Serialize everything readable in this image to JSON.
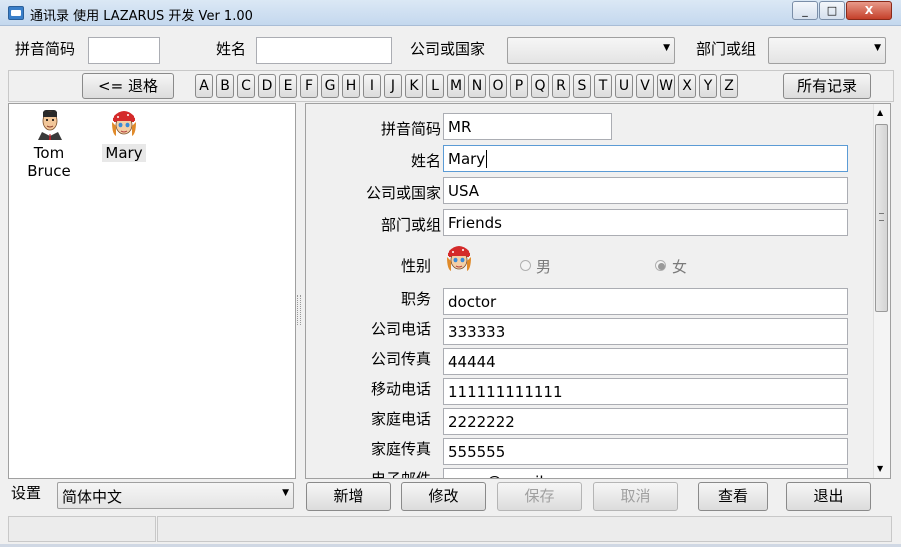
{
  "window": {
    "title": "通讯录 使用 LAZARUS 开发 Ver 1.00",
    "minimize": "_",
    "maximize": "□",
    "close": "X"
  },
  "search": {
    "pinyin_label": "拼音简码",
    "pinyin_value": "",
    "name_label": "姓名",
    "name_value": "",
    "company_label": "公司或国家",
    "company_value": "",
    "dept_label": "部门或组",
    "dept_value": ""
  },
  "nav": {
    "back_label": "<= 退格",
    "letters": [
      "A",
      "B",
      "C",
      "D",
      "E",
      "F",
      "G",
      "H",
      "I",
      "J",
      "K",
      "L",
      "M",
      "N",
      "O",
      "P",
      "Q",
      "R",
      "S",
      "T",
      "U",
      "V",
      "W",
      "X",
      "Y",
      "Z"
    ],
    "all_label": "所有记录"
  },
  "contacts": [
    {
      "name": "Tom\nBruce",
      "icon": "male-avatar-icon"
    },
    {
      "name": "Mary",
      "icon": "female-avatar-icon"
    }
  ],
  "settings": {
    "label": "设置",
    "language": "简体中文"
  },
  "form": {
    "pinyin": {
      "label": "拼音简码",
      "value": "MR"
    },
    "name": {
      "label": "姓名",
      "value": "Mary"
    },
    "company": {
      "label": "公司或国家",
      "value": "USA"
    },
    "dept": {
      "label": "部门或组",
      "value": "Friends"
    },
    "gender": {
      "label": "性别",
      "male": "男",
      "female": "女",
      "selected": "女"
    },
    "position": {
      "label": "职务",
      "value": "doctor"
    },
    "office_phone": {
      "label": "公司电话",
      "value": "333333"
    },
    "office_fax": {
      "label": "公司传真",
      "value": "44444"
    },
    "mobile": {
      "label": "移动电话",
      "value": "111111111111"
    },
    "home_phone": {
      "label": "家庭电话",
      "value": "2222222"
    },
    "home_fax": {
      "label": "家庭传真",
      "value": "555555"
    },
    "email": {
      "label": "电子邮件",
      "value": "mary@gmail.com"
    }
  },
  "actions": {
    "add": "新增",
    "edit": "修改",
    "save": "保存",
    "cancel": "取消",
    "view": "查看",
    "exit": "退出"
  }
}
